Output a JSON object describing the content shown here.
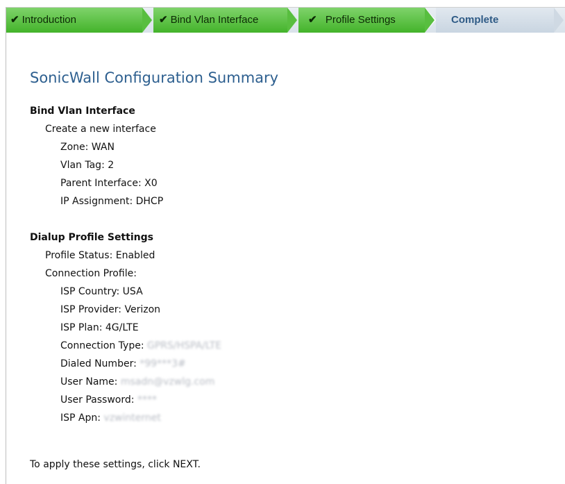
{
  "wizard": {
    "steps": [
      {
        "label": "Introduction",
        "state": "done"
      },
      {
        "label": "Bind Vlan Interface",
        "state": "done"
      },
      {
        "label": "Profile Settings",
        "state": "done"
      },
      {
        "label": "Complete",
        "state": "current"
      }
    ],
    "colors": {
      "done": "#4cb634",
      "current": "#2f5b86"
    }
  },
  "summary": {
    "title": "SonicWall Configuration Summary",
    "bind_vlan": {
      "heading": "Bind Vlan Interface",
      "create": "Create a new interface",
      "zone": "Zone: WAN",
      "vlan_tag": "Vlan Tag: 2",
      "parent_interface": "Parent Interface: X0",
      "ip_assignment": "IP Assignment: DHCP"
    },
    "dialup": {
      "heading": "Dialup Profile Settings",
      "profile_status": "Profile Status: Enabled",
      "connection_profile": "Connection Profile:",
      "isp_country": "ISP Country: USA",
      "isp_provider": "ISP Provider: Verizon",
      "isp_plan": "ISP Plan: 4G/LTE",
      "connection_type_label": "Connection Type:",
      "connection_type_value": "GPRS/HSPA/LTE",
      "dialed_number_label": "Dialed Number:",
      "dialed_number_value": "*99***3#",
      "user_name_label": "User Name:",
      "user_name_value": "msadn@vzwlg.com",
      "user_password_label": "User Password:",
      "user_password_value": "****",
      "isp_apn_label": "ISP Apn:",
      "isp_apn_value": "vzwinternet"
    },
    "footer": "To apply these settings, click NEXT."
  }
}
